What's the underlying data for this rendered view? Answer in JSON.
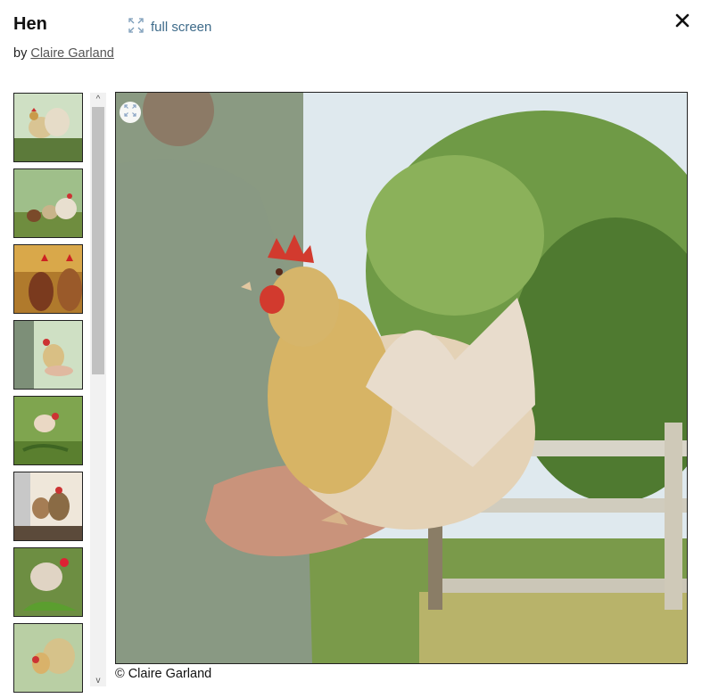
{
  "header": {
    "title": "Hen",
    "fullscreen_label": "full screen",
    "by_prefix": "by",
    "author": "Claire Garland"
  },
  "icons": {
    "fullscreen": "fullscreen-corners-icon",
    "close": "close-x-icon",
    "expand": "expand-icon",
    "scroll_up": "chevron-up-icon",
    "scroll_down": "chevron-down-icon"
  },
  "scroll_glyphs": {
    "up": "^",
    "down": "v"
  },
  "thumbnails": [
    {
      "alt": "hen thumbnail 1"
    },
    {
      "alt": "hen thumbnail 2"
    },
    {
      "alt": "hen thumbnail 3"
    },
    {
      "alt": "hen thumbnail 4"
    },
    {
      "alt": "hen thumbnail 5"
    },
    {
      "alt": "hen thumbnail 6"
    },
    {
      "alt": "hen thumbnail 7"
    },
    {
      "alt": "hen thumbnail 8"
    }
  ],
  "main_image": {
    "alt": "knitted hen held in hands outdoors"
  },
  "caption": "© Claire Garland",
  "colors": {
    "link": "#3e6b8a",
    "border": "#222222",
    "scroll_track": "#f1f1f1",
    "scroll_thumb": "#c1c1c1"
  }
}
